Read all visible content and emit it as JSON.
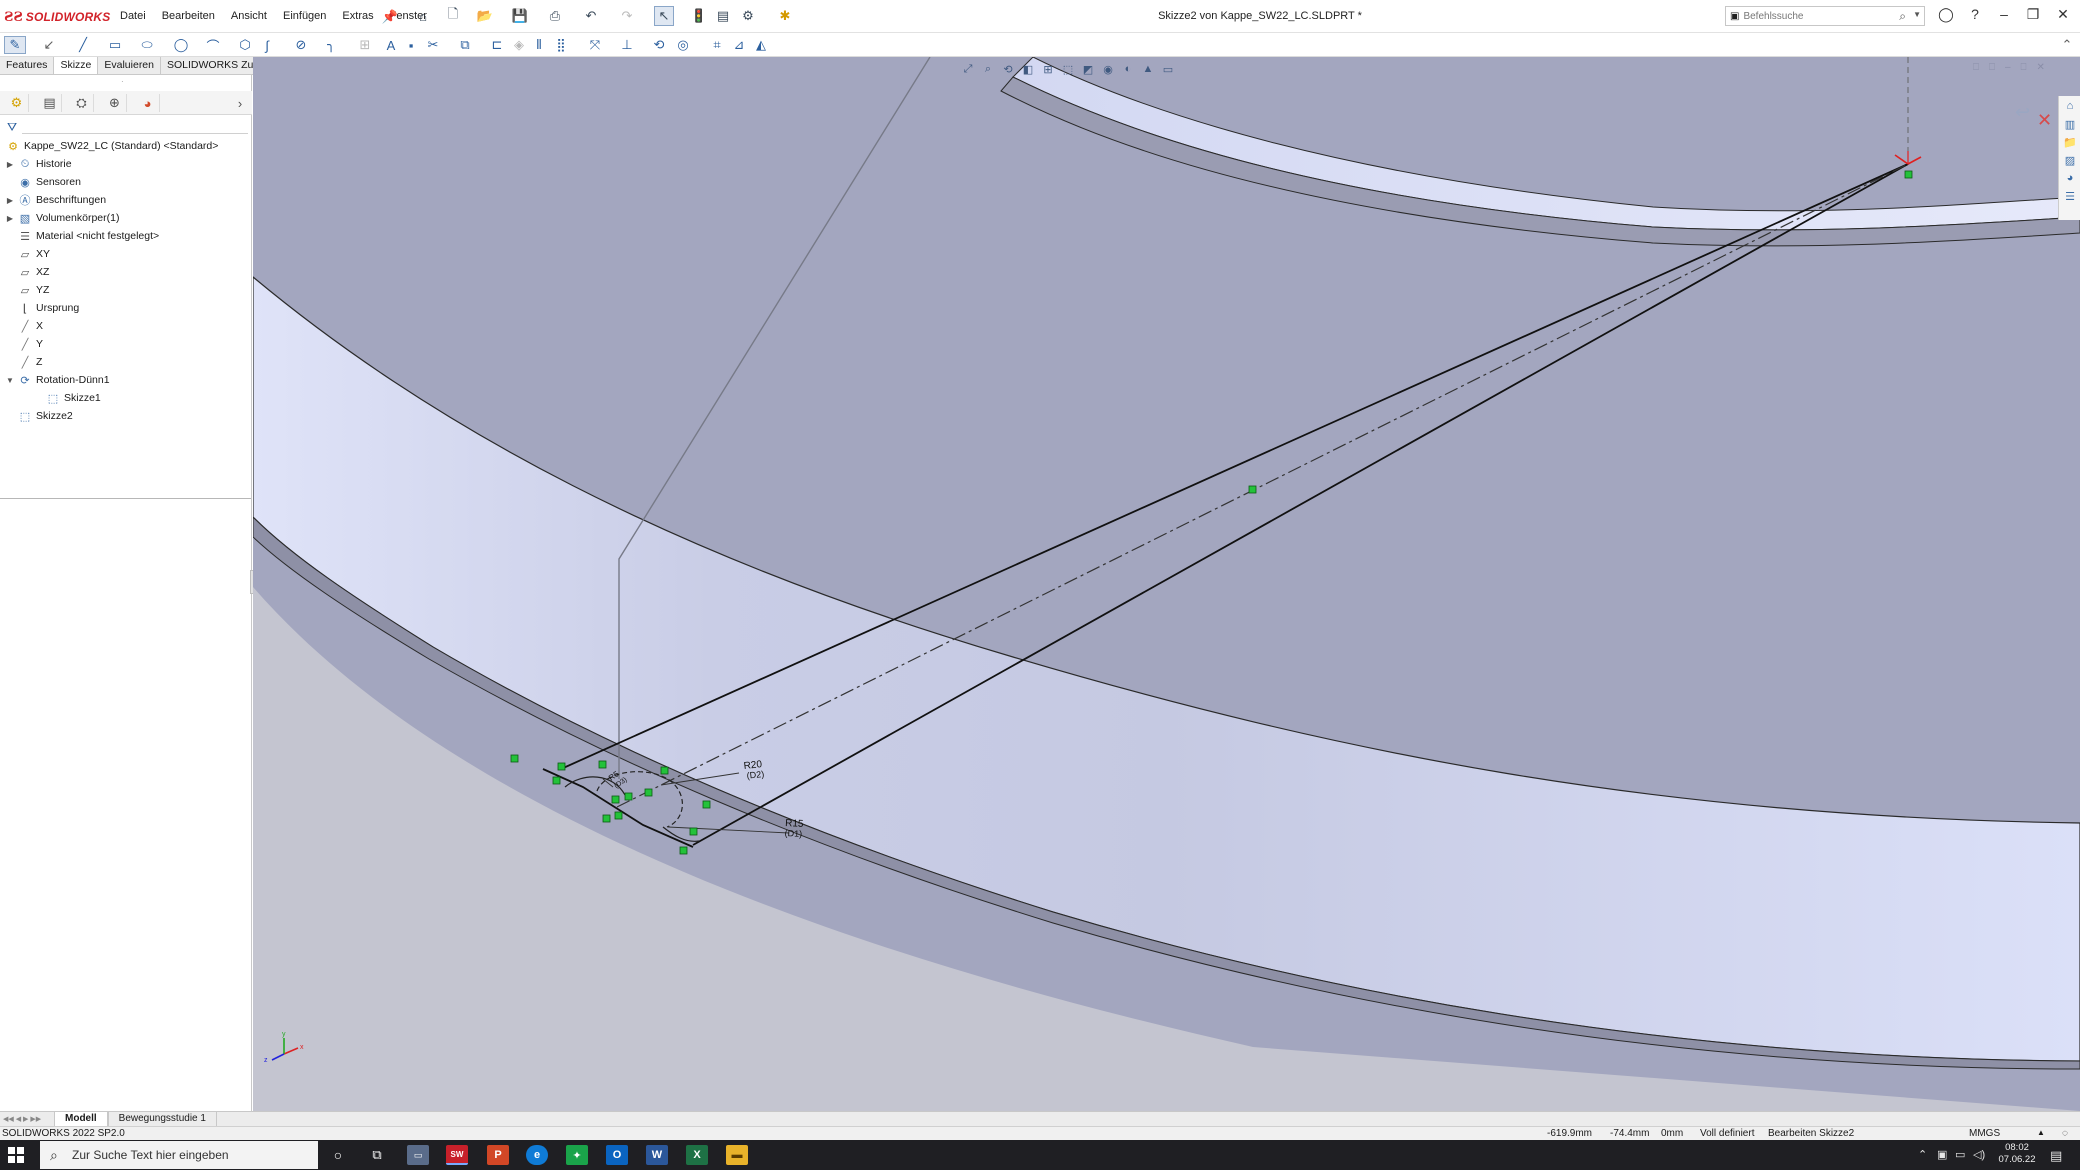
{
  "app": {
    "brand": "SOLIDWORKS",
    "brand_color": "#d2232a"
  },
  "window": {
    "title": "Skizze2 von Kappe_SW22_LC.SLDPRT *"
  },
  "menu": [
    "Datei",
    "Bearbeiten",
    "Ansicht",
    "Einfügen",
    "Extras",
    "Fenster"
  ],
  "search": {
    "placeholder": "Befehlssuche"
  },
  "tabs": [
    {
      "label": "Features",
      "active": false
    },
    {
      "label": "Skizze",
      "active": true
    },
    {
      "label": "Evaluieren",
      "active": false
    },
    {
      "label": "SOLIDWORKS Zusatzanwendungen",
      "active": false
    }
  ],
  "tree": {
    "root": "Kappe_SW22_LC (Standard) <Standard>",
    "items": [
      {
        "label": "Historie",
        "icon": "history-folder-icon",
        "expandable": true
      },
      {
        "label": "Sensoren",
        "icon": "sensor-icon",
        "expandable": false
      },
      {
        "label": "Beschriftungen",
        "icon": "annotations-icon",
        "expandable": true
      },
      {
        "label": "Volumenkörper(1)",
        "icon": "solid-bodies-icon",
        "expandable": true
      },
      {
        "label": "Material <nicht festgelegt>",
        "icon": "material-icon",
        "expandable": false
      },
      {
        "label": "XY",
        "icon": "plane-icon",
        "expandable": false
      },
      {
        "label": "XZ",
        "icon": "plane-icon",
        "expandable": false
      },
      {
        "label": "YZ",
        "icon": "plane-icon",
        "expandable": false
      },
      {
        "label": "Ursprung",
        "icon": "origin-icon",
        "expandable": false
      },
      {
        "label": "X",
        "icon": "axis-icon",
        "expandable": false
      },
      {
        "label": "Y",
        "icon": "axis-icon",
        "expandable": false
      },
      {
        "label": "Z",
        "icon": "axis-icon",
        "expandable": false
      },
      {
        "label": "Rotation-Dünn1",
        "icon": "revolve-thin-icon",
        "expandable": true,
        "expanded": true
      },
      {
        "label": "Skizze1",
        "icon": "sketch-icon",
        "expandable": false,
        "child": true
      },
      {
        "label": "Skizze2",
        "icon": "sketch-icon",
        "expandable": false
      }
    ]
  },
  "sketch": {
    "dimensions": [
      {
        "text": "R20",
        "sub": "(D2)"
      },
      {
        "text": "R15",
        "sub": "(D1)"
      },
      {
        "text": "R5",
        "sub": "(D3)"
      }
    ]
  },
  "bottom_tabs": [
    {
      "label": "Modell",
      "active": true
    },
    {
      "label": "Bewegungsstudie 1",
      "active": false
    }
  ],
  "status": {
    "version": "SOLIDWORKS 2022 SP2.0",
    "x": "-619.9mm",
    "y": "-74.4mm",
    "z": "0mm",
    "state": "Voll definiert",
    "mode": "Bearbeiten Skizze2",
    "units": "MMGS"
  },
  "taskbar": {
    "search_placeholder": "Zur Suche Text hier eingeben",
    "time": "08:02",
    "date": "07.06.22",
    "apps": [
      "PowerPoint",
      "Edge",
      "Outlook",
      "Word",
      "Excel",
      "Explorer"
    ]
  },
  "colors": {
    "viewport_bg": "#a3a6bf",
    "part_face": "#d8ddf4",
    "sketch_point": "#23c23a",
    "origin": "#e02020"
  }
}
